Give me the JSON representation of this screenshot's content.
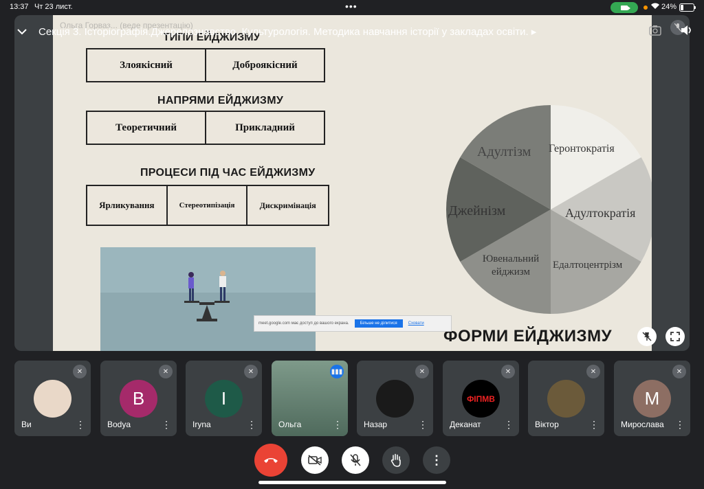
{
  "status": {
    "time": "13:37",
    "date": "Чт 23 лист.",
    "battery": "24%"
  },
  "meeting": {
    "title": "Секція 3. Історіографія.Джерелознавство. Культурологія. Методика навчання історії у закладах освіти.",
    "presenter_ghost": "Ольга Горваз... (веде презентацію)"
  },
  "slide": {
    "top_heading": "ТИПИ ЕЙДЖИЗМУ",
    "types": [
      "Злоякісний",
      "Доброякісний"
    ],
    "directions_heading": "НАПРЯМИ ЕЙДЖИЗМУ",
    "directions": [
      "Теоретичний",
      "Прикладний"
    ],
    "processes_heading": "ПРОЦЕСИ ПІД ЧАС ЕЙДЖИЗМУ",
    "processes": [
      "Ярликування",
      "Стереотипізація",
      "Дискримінація"
    ],
    "bottom_title": "ФОРМИ ЕЙДЖИЗМУ",
    "share_notice": "meet.google.com має доступ до вашого екрана.",
    "share_stop": "Більше не ділитися",
    "share_hide": "Сховати"
  },
  "pie": {
    "slices": [
      {
        "label": "Геронтократія",
        "color": "#f0efea"
      },
      {
        "label": "Адултократія",
        "color": "#c9c8c3"
      },
      {
        "label": "Едалтоцентрізм",
        "color": "#a7a7a2"
      },
      {
        "label": "Ювенальний ейджизм",
        "color": "#8e8f8a"
      },
      {
        "label": "Джейнізм",
        "color": "#5f625d"
      },
      {
        "label": "Адултізм",
        "color": "#7b7d78"
      }
    ]
  },
  "participants": [
    {
      "name": "Ви",
      "color": "#e9d8c8",
      "initial": "",
      "mic": "muted"
    },
    {
      "name": "Bodya",
      "color": "#a52a6a",
      "initial": "B",
      "mic": "muted"
    },
    {
      "name": "Iryna",
      "color": "#1e5a48",
      "initial": "I",
      "mic": "muted"
    },
    {
      "name": "Ольга",
      "color": "#6a8a7a",
      "initial": "",
      "mic": "active"
    },
    {
      "name": "Назар",
      "color": "#1a1a1a",
      "initial": "",
      "mic": "muted"
    },
    {
      "name": "Деканат",
      "color": "#000000",
      "initial": "ФІПМВ",
      "mic": "muted"
    },
    {
      "name": "Віктор",
      "color": "#6b5a3a",
      "initial": "",
      "mic": "muted"
    },
    {
      "name": "Мирослава",
      "color": "#8d6e63",
      "initial": "M",
      "mic": "muted"
    }
  ],
  "colors": {
    "end_call": "#ea4335",
    "bg": "#202124",
    "tile": "#3c4043"
  }
}
